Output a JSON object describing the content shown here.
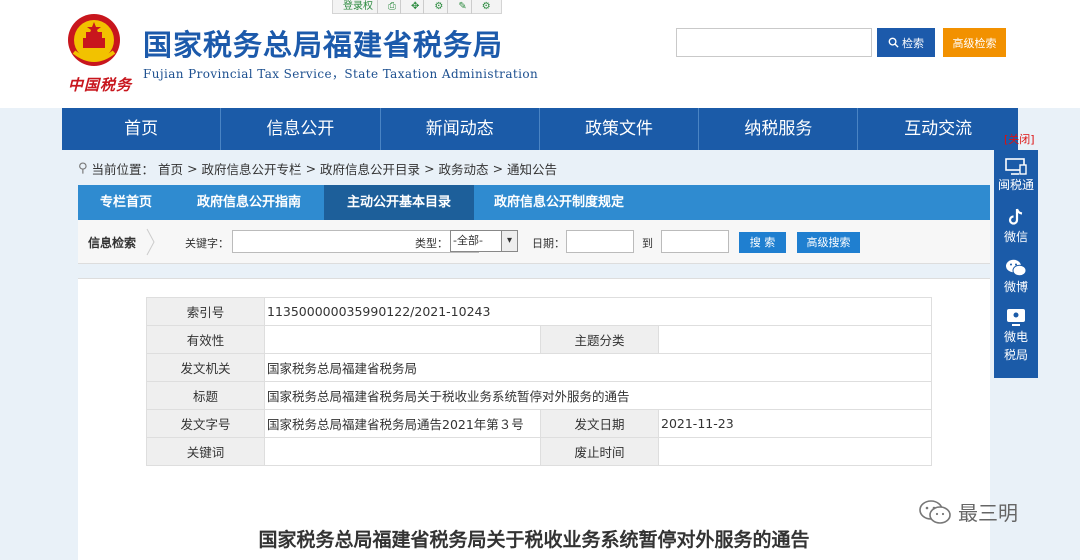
{
  "topbar": {
    "items": [
      "登录权",
      "",
      "",
      "",
      "",
      ""
    ]
  },
  "header": {
    "emblem_text": "中国税务",
    "title": "国家税务总局福建省税务局",
    "subtitle": "Fujian Provincial Tax Service，State Taxation Administration",
    "search_label": "检索",
    "advanced_search_label": "高级检索"
  },
  "nav": {
    "items": [
      "首页",
      "信息公开",
      "新闻动态",
      "政策文件",
      "纳税服务",
      "互动交流"
    ]
  },
  "breadcrumb": {
    "label": "当前位置：",
    "items": [
      "首页",
      "政府信息公开专栏",
      "政府信息公开目录",
      "政务动态",
      "通知公告"
    ],
    "separator": ">"
  },
  "tabs": {
    "items": [
      "专栏首页",
      "政府信息公开指南",
      "主动公开基本目录",
      "政府信息公开制度规定"
    ],
    "active_index": 2
  },
  "search_row": {
    "label": "信息检索",
    "keyword_label": "关键字：",
    "type_label": "类型：",
    "type_value": "-全部-",
    "date_label": "日期：",
    "to_label": "到",
    "search_button": "搜 索",
    "advanced_button": "高级搜索"
  },
  "meta": {
    "index_no_key": "索引号",
    "index_no": "11350000003599012​2/2021-10243",
    "validity_key": "有效性",
    "validity": "",
    "topic_key": "主题分类",
    "topic": "",
    "issuer_key": "发文机关",
    "issuer": "国家税务总局福建省税务局",
    "title_key": "标题",
    "title": "国家税务总局福建省税务局关于税收业务系统暂停对外服务的通告",
    "doc_no_key": "发文字号",
    "doc_no": "国家税务总局福建省税务局通告2021年第３号",
    "date_key": "发文日期",
    "date": "2021-11-23",
    "keywords_key": "关键词",
    "keywords": "",
    "expiry_key": "废止时间",
    "expiry": ""
  },
  "notice_title": "国家税务总局福建省税务局关于税收业务系统暂停对外服务的通告",
  "side": {
    "close_label": "[关闭]",
    "items": [
      "闽税通",
      "微信",
      "微博",
      "微电税局"
    ]
  },
  "watermark": "最三明",
  "colors": {
    "brand_blue": "#1b5ba8",
    "tab_blue": "#2f8bd0",
    "orange": "#f29100",
    "red": "#c8161d"
  }
}
